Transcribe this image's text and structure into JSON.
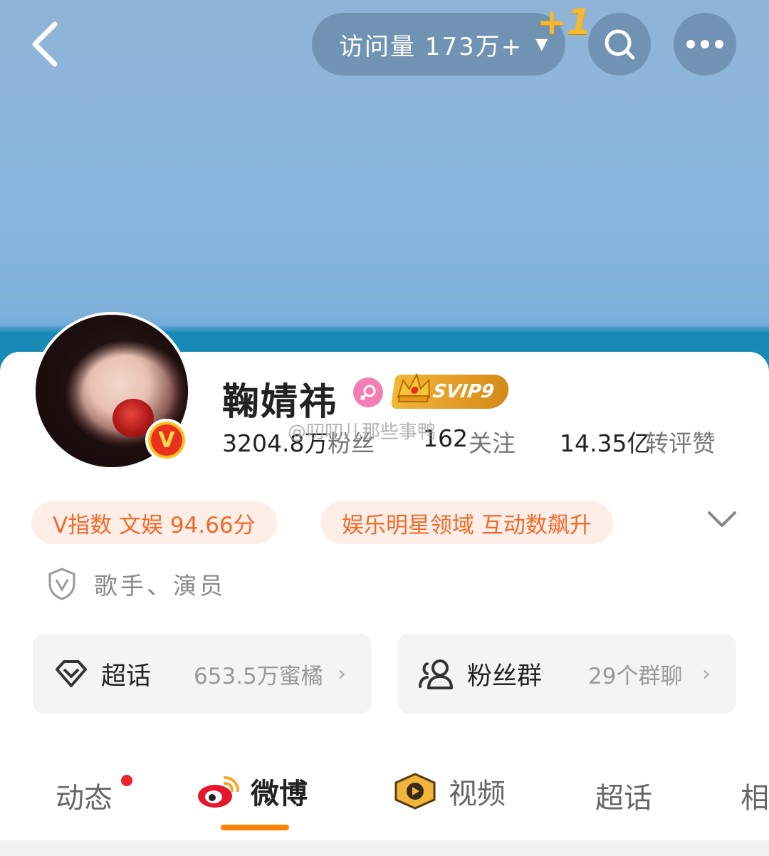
{
  "header": {
    "visits_label": "访问量 173万+",
    "plus_one": "+1"
  },
  "profile": {
    "name": "鞠婧祎",
    "vip_label": "SVIP9",
    "stats": [
      {
        "value": "3204.8万",
        "label": "粉丝"
      },
      {
        "value": "162",
        "label": "关注"
      },
      {
        "value": "14.35亿",
        "label": "转评赞"
      }
    ],
    "watermark": "@叨叨儿那些事鸭"
  },
  "tags": [
    "V指数 文娱 94.66分",
    "娱乐明星领域 互动数飙升"
  ],
  "certification": "歌手、演员",
  "entries": {
    "super_topic": {
      "title": "超话",
      "sub": "653.5万蜜橘"
    },
    "fan_group": {
      "title": "粉丝群",
      "sub": "29个群聊"
    }
  },
  "tabs": [
    "动态",
    "微博",
    "视频",
    "超话",
    "相"
  ],
  "colors": {
    "accent": "#ff8200",
    "tag_text": "#f26a28",
    "tag_bg": "#fdeee8"
  }
}
